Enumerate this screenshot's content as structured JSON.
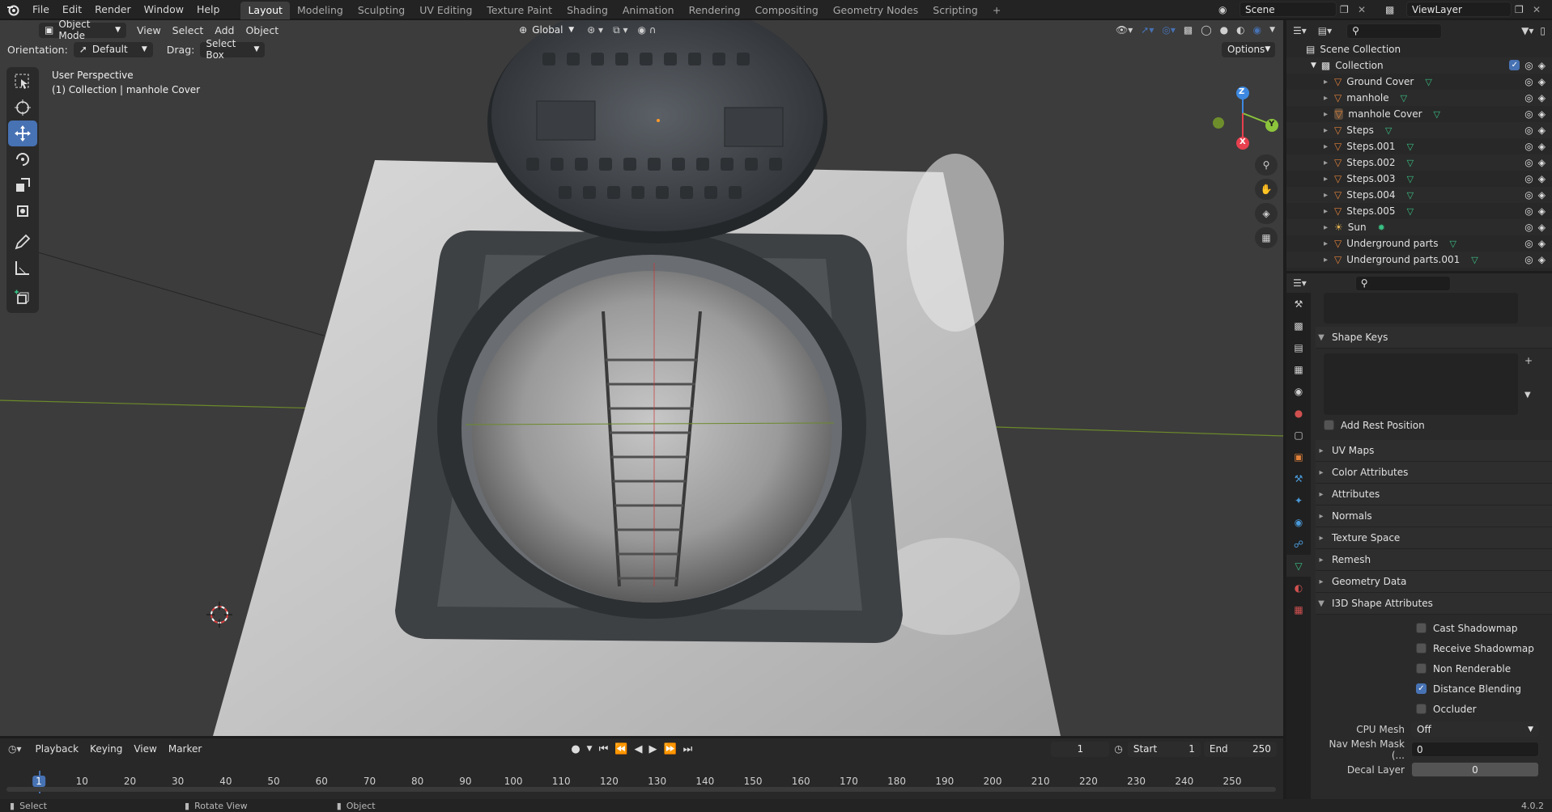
{
  "menubar": {
    "items": [
      "File",
      "Edit",
      "Render",
      "Window",
      "Help"
    ],
    "workspaces": [
      "Layout",
      "Modeling",
      "Sculpting",
      "UV Editing",
      "Texture Paint",
      "Shading",
      "Animation",
      "Rendering",
      "Compositing",
      "Geometry Nodes",
      "Scripting"
    ],
    "active_workspace": "Layout",
    "add_tab": "+",
    "scene": "Scene",
    "view_layer": "ViewLayer"
  },
  "viewport_header": {
    "mode": "Object Mode",
    "menus": [
      "View",
      "Select",
      "Add",
      "Object"
    ],
    "transform_orientation": "Global",
    "orientation_label": "Orientation:",
    "orientation_value": "Default",
    "drag_label": "Drag:",
    "drag_value": "Select Box",
    "options": "Options"
  },
  "viewport": {
    "view_name": "User Perspective",
    "collection_info": "(1) Collection | manhole Cover",
    "gizmo": {
      "x": "X",
      "y": "Y",
      "z": "Z"
    }
  },
  "outliner": {
    "root": "Scene Collection",
    "collection": "Collection",
    "items": [
      {
        "name": "Ground Cover",
        "type": "mesh"
      },
      {
        "name": "manhole",
        "type": "mesh"
      },
      {
        "name": "manhole Cover",
        "type": "mesh",
        "selected": true
      },
      {
        "name": "Steps",
        "type": "mesh"
      },
      {
        "name": "Steps.001",
        "type": "mesh"
      },
      {
        "name": "Steps.002",
        "type": "mesh"
      },
      {
        "name": "Steps.003",
        "type": "mesh"
      },
      {
        "name": "Steps.004",
        "type": "mesh"
      },
      {
        "name": "Steps.005",
        "type": "mesh"
      },
      {
        "name": "Sun",
        "type": "light"
      },
      {
        "name": "Underground parts",
        "type": "mesh"
      },
      {
        "name": "Underground parts.001",
        "type": "mesh"
      }
    ]
  },
  "properties": {
    "shape_keys": "Shape Keys",
    "add_rest_position": "Add Rest Position",
    "panels": [
      "UV Maps",
      "Color Attributes",
      "Attributes",
      "Normals",
      "Texture Space",
      "Remesh",
      "Geometry Data"
    ],
    "i3d_panel": "I3D Shape Attributes",
    "checkboxes": [
      {
        "label": "Cast Shadowmap",
        "checked": false
      },
      {
        "label": "Receive Shadowmap",
        "checked": false
      },
      {
        "label": "Non Renderable",
        "checked": false
      },
      {
        "label": "Distance Blending",
        "checked": true
      },
      {
        "label": "Occluder",
        "checked": false
      }
    ],
    "cpu_mesh_label": "CPU Mesh",
    "cpu_mesh_value": "Off",
    "nav_mesh_label": "Nav Mesh Mask (...",
    "nav_mesh_value": "0",
    "decal_layer_label": "Decal Layer",
    "decal_layer_value": "0"
  },
  "timeline": {
    "menus": [
      "Playback",
      "Keying",
      "View",
      "Marker"
    ],
    "current_frame": "1",
    "start_label": "Start",
    "start_value": "1",
    "end_label": "End",
    "end_value": "250",
    "ticks": [
      "1",
      "10",
      "20",
      "30",
      "40",
      "50",
      "60",
      "70",
      "80",
      "90",
      "100",
      "110",
      "120",
      "130",
      "140",
      "150",
      "160",
      "170",
      "180",
      "190",
      "200",
      "210",
      "220",
      "230",
      "240",
      "250"
    ]
  },
  "statusbar": {
    "select": "Select",
    "rotate": "Rotate View",
    "object": "Object",
    "version": "4.0.2"
  },
  "colors": {
    "accent": "#4772b3",
    "mesh_icon": "#e0813a",
    "data_icon": "#39c184",
    "axis_x": "#e8404f",
    "axis_y": "#8cc43c",
    "axis_z": "#3d89e1"
  }
}
